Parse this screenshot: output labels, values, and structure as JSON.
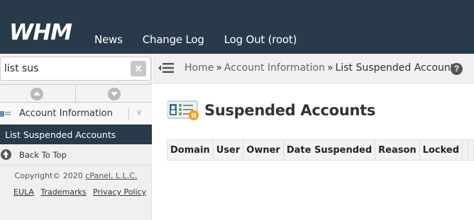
{
  "header": {
    "logo_text": "WHM",
    "nav": [
      {
        "label": "News"
      },
      {
        "label": "Change Log"
      },
      {
        "label": "Log Out (root)"
      }
    ]
  },
  "sidebar": {
    "search": {
      "value": "list sus",
      "clear_icon": "close-icon"
    },
    "category": {
      "label": "Account Information",
      "chevron": "∨"
    },
    "active_item": {
      "label": "List Suspended Accounts"
    },
    "back_to_top": {
      "label": "Back To Top"
    },
    "copyright": {
      "prefix": "Copyright© 2020 ",
      "company": "cPanel, L.L.C."
    },
    "footer_links": [
      {
        "label": "EULA"
      },
      {
        "label": "Trademarks"
      },
      {
        "label": "Privacy Policy"
      }
    ]
  },
  "breadcrumb": {
    "items": [
      {
        "label": "Home"
      },
      {
        "label": "Account Information"
      },
      {
        "label": "List Suspended Accounts"
      }
    ],
    "separator": "»",
    "help": "?"
  },
  "main": {
    "title": "Suspended Accounts",
    "table": {
      "columns": [
        "Domain",
        "User",
        "Owner",
        "Date Suspended",
        "Reason",
        "Locked"
      ],
      "rows": []
    }
  },
  "colors": {
    "header_bg": "#293a4a",
    "active_bg": "#293a4a",
    "accent_orange": "#f39c12"
  }
}
